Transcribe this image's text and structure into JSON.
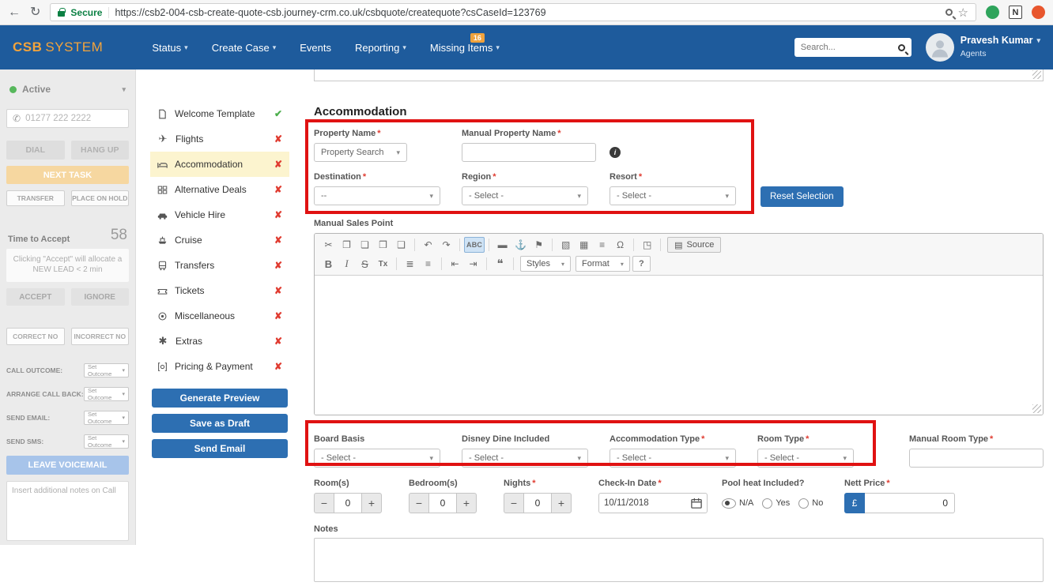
{
  "browser": {
    "secure_label": "Secure",
    "url": "https://csb2-004-csb-create-quote-csb.journey-crm.co.uk/csbquote/createquote?csCaseId=123769",
    "extension_n": "N"
  },
  "icons": {
    "check": "✔",
    "x": "✘",
    "caret": "▾"
  },
  "nav": {
    "brand_primary": "CSB",
    "brand_secondary": "SYSTEM",
    "items": [
      {
        "label": "Status"
      },
      {
        "label": "Create Case"
      },
      {
        "label": "Events"
      },
      {
        "label": "Reporting"
      },
      {
        "label": "Missing Items",
        "badge": "16"
      }
    ],
    "search_placeholder": "Search...",
    "user": {
      "name": "Pravesh Kumar",
      "role": "Agents"
    }
  },
  "call_panel": {
    "status_label": "Active",
    "phone_number": "01277 222 2222",
    "dial_label": "DIAL",
    "hang_up_label": "HANG UP",
    "next_task_label": "NEXT TASK",
    "transfer_label": "TRANSFER",
    "place_on_hold_label": "PLACE ON HOLD",
    "time_to_accept_label": "Time to Accept",
    "time_to_accept_value": "58",
    "accept_hint": "Clicking \"Accept\" will allocate a NEW LEAD < 2 min",
    "accept_label": "ACCEPT",
    "ignore_label": "IGNORE",
    "correct_no_label": "CORRECT NO",
    "incorrect_no_label": "INCORRECT NO",
    "outcomes": [
      {
        "label": "CALL OUTCOME:",
        "value": "Set Outcome"
      },
      {
        "label": "ARRANGE CALL BACK:",
        "value": "Set Outcome"
      },
      {
        "label": "SEND EMAIL:",
        "value": "Set Outcome"
      },
      {
        "label": "SEND SMS:",
        "value": "Set Outcome"
      }
    ],
    "leave_voicemail_label": "LEAVE VOICEMAIL",
    "notes_placeholder": "Insert additional notes on Call"
  },
  "quote_menu": {
    "items": [
      {
        "label": "Welcome Template",
        "status": "complete"
      },
      {
        "label": "Flights",
        "status": "incomplete"
      },
      {
        "label": "Accommodation",
        "status": "incomplete",
        "active": true
      },
      {
        "label": "Alternative Deals",
        "status": "incomplete"
      },
      {
        "label": "Vehicle Hire",
        "status": "incomplete"
      },
      {
        "label": "Cruise",
        "status": "incomplete"
      },
      {
        "label": "Transfers",
        "status": "incomplete"
      },
      {
        "label": "Tickets",
        "status": "incomplete"
      },
      {
        "label": "Miscellaneous",
        "status": "incomplete"
      },
      {
        "label": "Extras",
        "status": "incomplete"
      },
      {
        "label": "Pricing & Payment",
        "status": "incomplete"
      }
    ],
    "generate_preview_label": "Generate Preview",
    "save_as_draft_label": "Save as Draft",
    "send_email_label": "Send Email"
  },
  "form": {
    "title": "Accommodation",
    "property_name": {
      "label": "Property Name",
      "value": "Property Search"
    },
    "manual_property_name": {
      "label": "Manual Property Name",
      "value": ""
    },
    "destination": {
      "label": "Destination",
      "value": "--"
    },
    "region": {
      "label": "Region",
      "value": "- Select -"
    },
    "resort": {
      "label": "Resort",
      "value": "- Select -"
    },
    "reset_selection_label": "Reset Selection",
    "manual_sales_point_label": "Manual Sales Point",
    "editor": {
      "bold": "B",
      "italic": "I",
      "strike": "S",
      "remove_format": "Tx",
      "spell": "ABC",
      "styles_label": "Styles",
      "format_label": "Format",
      "help_label": "?",
      "source_label": "Source"
    },
    "board_basis": {
      "label": "Board Basis",
      "value": "- Select -"
    },
    "disney_dine": {
      "label": "Disney Dine Included",
      "value": "- Select -"
    },
    "accommodation_type": {
      "label": "Accommodation Type",
      "value": "- Select -"
    },
    "room_type": {
      "label": "Room Type",
      "value": "- Select -"
    },
    "manual_room_type": {
      "label": "Manual Room Type",
      "value": ""
    },
    "rooms": {
      "label": "Room(s)",
      "value": "0"
    },
    "bedrooms": {
      "label": "Bedroom(s)",
      "value": "0"
    },
    "nights": {
      "label": "Nights",
      "value": "0"
    },
    "check_in": {
      "label": "Check-In Date",
      "value": "10/11/2018"
    },
    "pool_heat": {
      "label": "Pool heat Included?",
      "options": [
        "N/A",
        "Yes",
        "No"
      ],
      "selected": "N/A"
    },
    "nett_price": {
      "label": "Nett Price",
      "currency": "£",
      "value": "0"
    },
    "notes_label": "Notes"
  }
}
